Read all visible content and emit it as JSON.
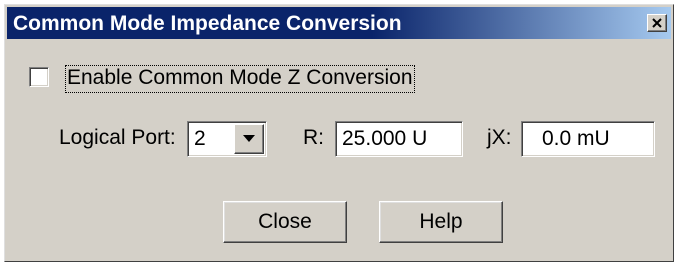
{
  "window": {
    "title": "Common Mode Impedance Conversion",
    "title_bar_color": "#0a246a"
  },
  "enable_checkbox": {
    "label": "Enable Common Mode Z Conversion",
    "checked": false
  },
  "logical_port": {
    "label": "Logical Port:",
    "value": "2"
  },
  "r_field": {
    "label": "R:",
    "value": "25.000 U"
  },
  "x_field": {
    "label": "jX:",
    "value": "0.0 mU"
  },
  "buttons": {
    "close": "Close",
    "help": "Help"
  },
  "icons": {
    "window_close": "close-icon",
    "dropdown": "chevron-down-icon"
  }
}
